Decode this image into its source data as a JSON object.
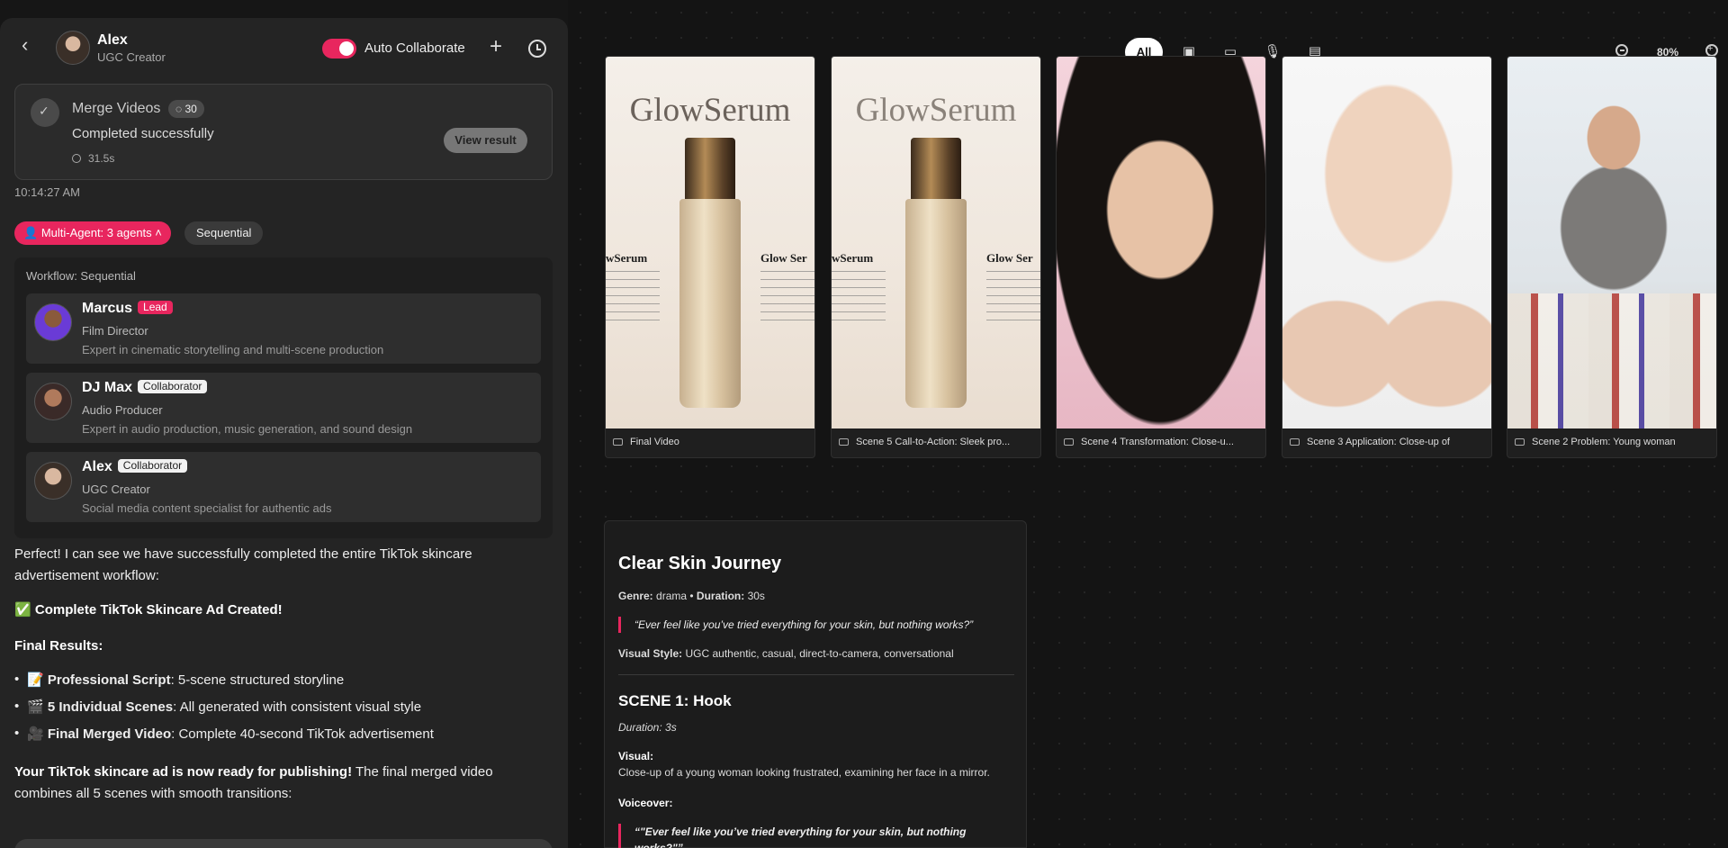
{
  "header": {
    "name": "Alex",
    "role": "UGC Creator",
    "toggle_label": "Auto Collaborate"
  },
  "merge": {
    "title": "Merge Videos",
    "badge": "30",
    "status": "Completed successfully",
    "duration": "31.5s",
    "button": "View result",
    "timestamp": "10:14:27 AM"
  },
  "multi_agent": {
    "pill": "Multi-Agent: 3 agents",
    "mode": "Sequential",
    "workflow_label": "Workflow: Sequential",
    "agents": [
      {
        "name": "Marcus",
        "tag": "Lead",
        "role": "Film Director",
        "desc": "Expert in cinematic storytelling and multi-scene production"
      },
      {
        "name": "DJ Max",
        "tag": "Collaborator",
        "role": "Audio Producer",
        "desc": "Expert in audio production, music generation, and sound design"
      },
      {
        "name": "Alex",
        "tag": "Collaborator",
        "role": "UGC Creator",
        "desc": "Social media content specialist for authentic ads"
      }
    ]
  },
  "message": {
    "intro": "Perfect! I can see we have successfully completed the entire TikTok skincare advertisement workflow:",
    "headline_emoji": "✅",
    "headline": "Complete TikTok Skincare Ad Created!",
    "results_label": "Final Results:",
    "bullets": [
      {
        "emoji": "📝",
        "bold": "Professional Script",
        "text": ": 5-scene structured storyline"
      },
      {
        "emoji": "🎬",
        "bold": "5 Individual Scenes",
        "text": ": All generated with consistent visual style"
      },
      {
        "emoji": "🎥",
        "bold": "Final Merged Video",
        "text": ": Complete 40-second TikTok advertisement"
      }
    ],
    "closing_bold": "Your TikTok skincare ad is now ready for publishing!",
    "closing_text": " The final merged video combines all 5 scenes with smooth transitions:"
  },
  "filters": {
    "all": "All",
    "icons": [
      "image-icon",
      "video-icon",
      "mic-icon",
      "document-icon"
    ]
  },
  "zoom": {
    "level": "80%"
  },
  "thumbnails": [
    {
      "label": "Final Video",
      "brand": "GlowSerum",
      "left_text": "wSerum",
      "right_text": "Glow Ser"
    },
    {
      "label": "Scene 5 Call-to-Action: Sleek pro...",
      "brand": "GlowSerum",
      "left_text": "wSerum",
      "right_text": "Glow Ser"
    },
    {
      "label": "Scene 4 Transformation: Close-u..."
    },
    {
      "label": "Scene 3 Application: Close-up of"
    },
    {
      "label": "Scene 2 Problem: Young woman"
    }
  ],
  "script": {
    "title": "Clear Skin Journey",
    "genre_label": "Genre:",
    "genre": " drama • ",
    "duration_label": "Duration:",
    "duration": " 30s",
    "tagline": "“Ever feel like you’ve tried everything for your skin, but nothing works?”",
    "style_label": "Visual Style:",
    "style": " UGC authentic, casual, direct-to-camera, conversational",
    "scene_title": "SCENE 1: Hook",
    "scene_duration": "Duration: 3s",
    "visual_label": "Visual:",
    "visual": "Close-up of a young woman looking frustrated, examining her face in a mirror.",
    "voiceover_label": "Voiceover:",
    "voiceover": "“\"Ever feel like you’ve tried everything for your skin, but nothing works?\"”"
  },
  "colors": {
    "accent": "#e8265e",
    "panel": "#242424",
    "canvas": "#141414"
  }
}
